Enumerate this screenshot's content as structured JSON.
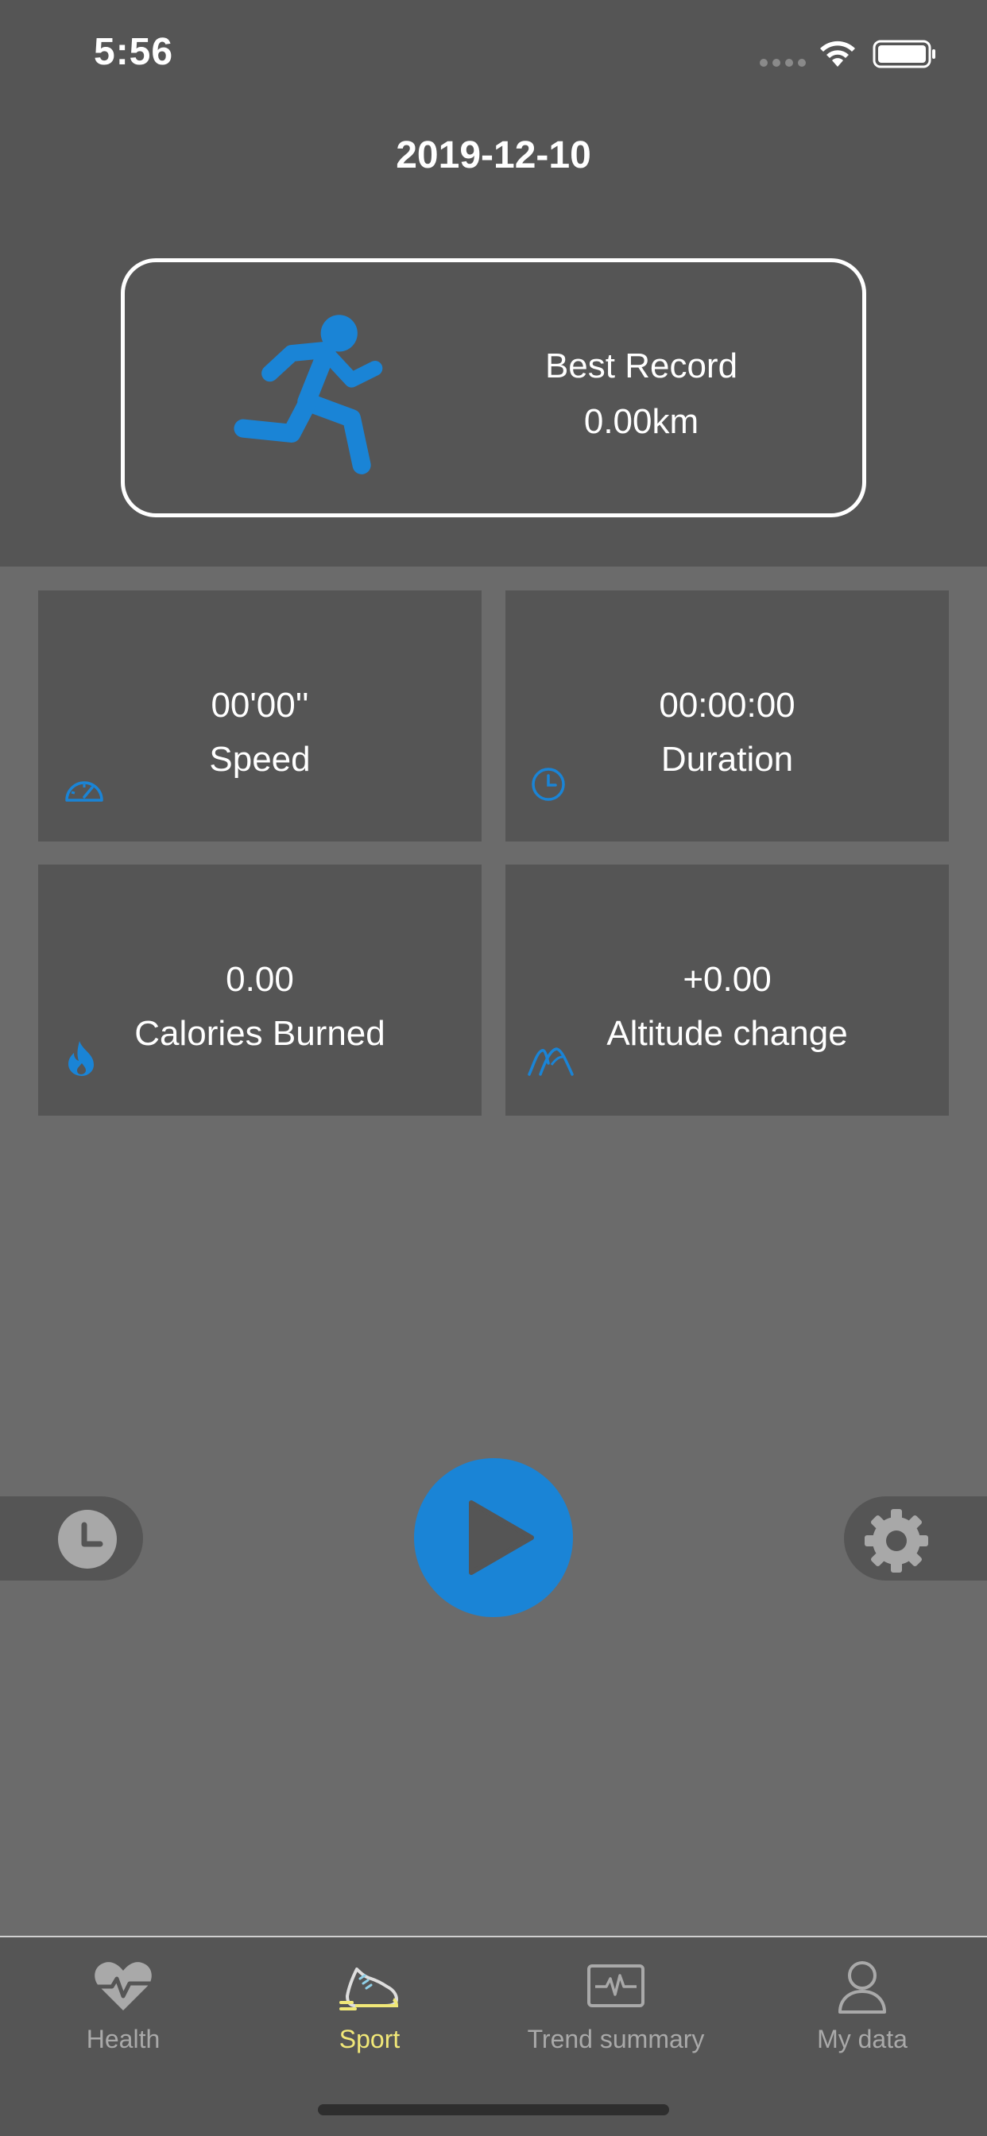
{
  "status_bar": {
    "time": "5:56"
  },
  "header": {
    "date": "2019-12-10"
  },
  "best_record": {
    "label": "Best Record",
    "value": "0.00km"
  },
  "stats": [
    {
      "value": "00'00''",
      "label": "Speed",
      "icon": "speedometer-icon"
    },
    {
      "value": "00:00:00",
      "label": "Duration",
      "icon": "clock-icon"
    },
    {
      "value": "0.00",
      "label": "Calories Burned",
      "icon": "flame-icon"
    },
    {
      "value": "+0.00",
      "label": "Altitude change",
      "icon": "mountain-icon"
    }
  ],
  "controls": {
    "left_icon": "history-clock-icon",
    "center_icon": "play-icon",
    "right_icon": "gear-icon"
  },
  "tabs": [
    {
      "label": "Health",
      "icon": "heart-pulse-icon",
      "active": false
    },
    {
      "label": "Sport",
      "icon": "shoe-icon",
      "active": true
    },
    {
      "label": "Trend summary",
      "icon": "trend-monitor-icon",
      "active": false
    },
    {
      "label": "My data",
      "icon": "person-icon",
      "active": false
    }
  ],
  "colors": {
    "accent_blue": "#1a84d6",
    "active_tab": "#f1e878",
    "inactive_tab": "#a9a9a9",
    "header_bg": "#555555",
    "page_bg": "#6b6b6b"
  }
}
